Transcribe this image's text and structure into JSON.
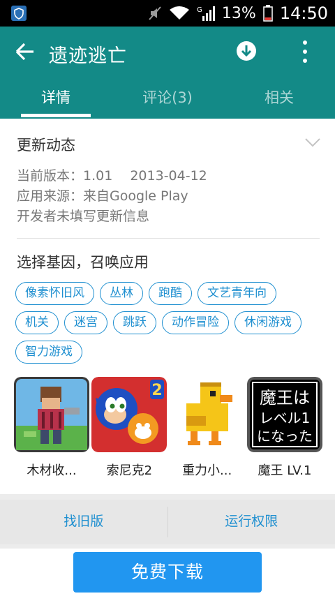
{
  "status_bar": {
    "battery": "13%",
    "time": "14:50",
    "network_letter": "G"
  },
  "header": {
    "title": "遗迹逃亡"
  },
  "tabs": [
    {
      "label": "详情",
      "active": true
    },
    {
      "label": "评论(3)",
      "active": false
    },
    {
      "label": "相关",
      "active": false
    }
  ],
  "update": {
    "title": "更新动态",
    "version_line": "当前版本：1.01　 2013-04-12",
    "source_line": "应用来源：来自Google Play",
    "note_line": "开发者未填写更新信息"
  },
  "genes": {
    "title": "选择基因，召唤应用",
    "tags": [
      "像素怀旧风",
      "丛林",
      "跑酷",
      "文艺青年向",
      "机关",
      "迷宫",
      "跳跃",
      "动作冒险",
      "休闲游戏",
      "智力游戏"
    ]
  },
  "related_apps": [
    {
      "name": "木材收...",
      "icon": "lumberjack-pixel-icon"
    },
    {
      "name": "索尼克2",
      "icon": "sonic2-icon"
    },
    {
      "name": "重力小...",
      "icon": "pixel-duck-icon"
    },
    {
      "name": "魔王 LV.1",
      "icon": "maou-level1-icon",
      "icon_text_1": "魔王は",
      "icon_text_2": "レベル1",
      "icon_text_3": "になった"
    }
  ],
  "actions": {
    "old_version": "找旧版",
    "permissions": "运行权限"
  },
  "download": {
    "label": "免费下载"
  },
  "colors": {
    "header": "#138a87",
    "accent": "#1e8fd0",
    "button": "#2196f0"
  }
}
